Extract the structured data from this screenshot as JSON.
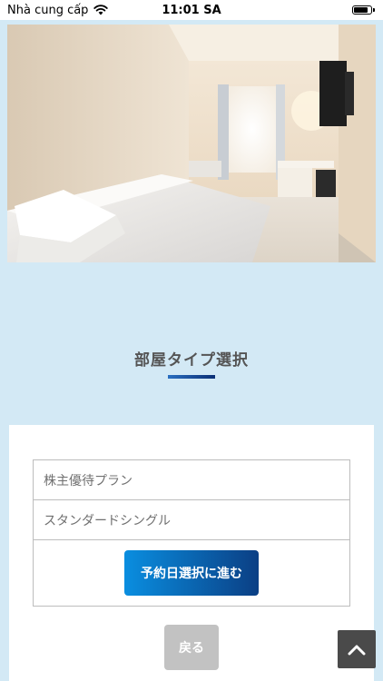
{
  "status_bar": {
    "carrier": "Nhà cung cấp",
    "time": "11:01 SA",
    "battery_level": 0.9
  },
  "hero": {
    "icon": "hotel-room-photo"
  },
  "section": {
    "title": "部屋タイプ選択"
  },
  "plan": {
    "plan_name": "株主優待プラン",
    "room_type": "スタンダードシングル",
    "proceed_label": "予約日選択に進む"
  },
  "footer": {
    "back_label": "戻る",
    "scroll_top_icon": "chevron-up-icon"
  },
  "colors": {
    "page_background": "#d3e9f5",
    "accent_gradient_start": "#0a8ee0",
    "accent_gradient_end": "#0b3f84",
    "back_button": "#c2c2c2",
    "scroll_top": "#4a4a4a"
  }
}
